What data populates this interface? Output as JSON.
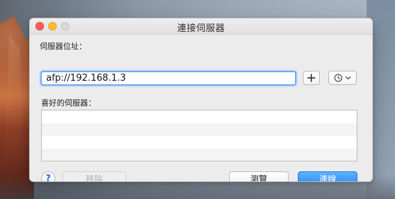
{
  "window": {
    "title": "連接伺服器",
    "traffic_lights": {
      "close_color": "#ff5f57",
      "minimize_color": "#ffbd2e",
      "zoom_color": "#d8d8d8"
    }
  },
  "form": {
    "server_address_label": "伺服器位址：",
    "server_address_value": "afp://192.168.1.3",
    "favorites_label": "喜好的伺服器：",
    "favorites_items": []
  },
  "buttons": {
    "help_label": "?",
    "remove_label": "移除",
    "browse_label": "瀏覽",
    "connect_label": "連線"
  },
  "icons": {
    "add": "plus-icon",
    "recent": "clock-icon",
    "dropdown": "chevron-down-icon",
    "help": "question-mark-icon"
  },
  "colors": {
    "accent": "#2b8cff",
    "focus_ring": "#6ea8f7",
    "window_background": "#ececec"
  }
}
